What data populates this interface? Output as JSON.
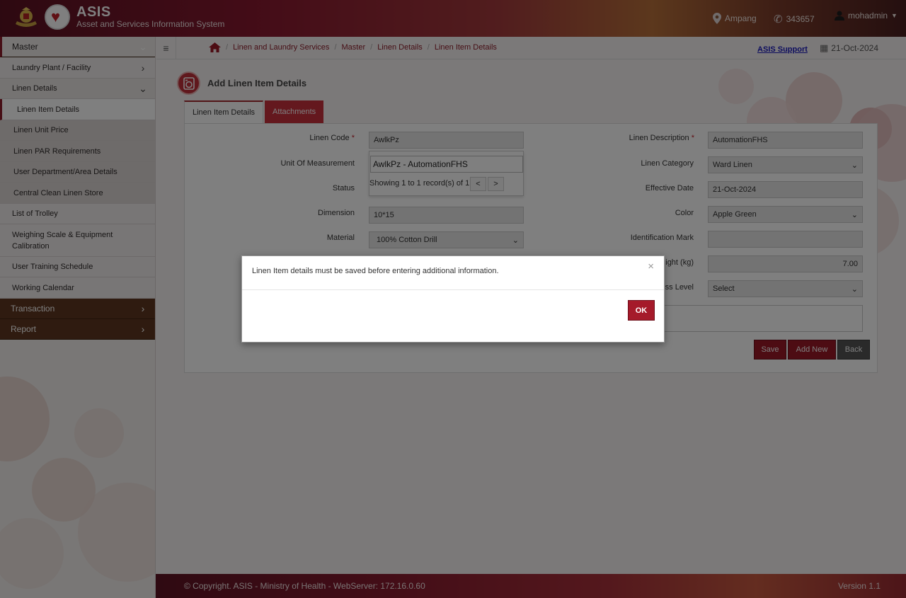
{
  "header": {
    "title": "ASIS",
    "subtitle": "Asset and Services Information System",
    "location": "Ampang",
    "phone": "343657",
    "user": "mohadmin"
  },
  "sidebar": {
    "master": "Master",
    "laundry_plant": "Laundry Plant / Facility",
    "linen_details": "Linen Details",
    "linen_item_details": "Linen Item Details",
    "linen_unit_price": "Linen Unit Price",
    "linen_par": "Linen PAR Requirements",
    "user_dept": "User Department/Area Details",
    "central_store": "Central Clean Linen Store",
    "list_trolley": "List of Trolley",
    "weighing": "Weighing Scale & Equipment Calibration",
    "user_training": "User Training Schedule",
    "working_calendar": "Working Calendar",
    "transaction": "Transaction",
    "report": "Report"
  },
  "topbar": {
    "breadcrumb": [
      "Linen and Laundry Services",
      "Master",
      "Linen Details",
      "Linen Item Details"
    ],
    "support": "ASIS Support",
    "date": "21-Oct-2024"
  },
  "page": {
    "title": "Add Linen Item Details",
    "tabs": [
      "Linen Item Details",
      "Attachments"
    ]
  },
  "form": {
    "linen_code_label": "Linen Code",
    "linen_code_value": "AwlkPz",
    "uom_label": "Unit Of Measurement",
    "status_label": "Status",
    "dimension_label": "Dimension",
    "dimension_value": "10*15",
    "material_label": "Material",
    "material_value": "100% Cotton Drill",
    "linen_desc_label": "Linen Description",
    "linen_desc_value": "AutomationFHS",
    "linen_category_label": "Linen Category",
    "linen_category_value": "Ward Linen",
    "effective_date_label": "Effective Date",
    "effective_date_value": "21-Oct-2024",
    "color_label": "Color",
    "color_value": "Apple Green",
    "identification_label": "Identification Mark",
    "weight_label_partial": "ight (kg)",
    "weight_value": "7.00",
    "level_label_partial": "ss Level",
    "level_value": "Select",
    "required_mark": "*"
  },
  "autocomplete": {
    "option": "AwlkPz - AutomationFHS",
    "info": "Showing 1 to 1 record(s) of 1",
    "prev": "<",
    "next": ">"
  },
  "buttons": {
    "save": "Save",
    "add_new": "Add New",
    "back": "Back"
  },
  "modal": {
    "message": "Linen Item details must be saved before entering additional information.",
    "close": "×",
    "ok": "OK"
  },
  "footer": {
    "copyright": "© Copyright. ASIS - Ministry of Health - WebServer: 172.16.0.60",
    "version": "Version 1.1"
  },
  "colors": {
    "brand": "#8c1d2a",
    "tab_red": "#c8303d",
    "sidebar_section": "#5e3720"
  }
}
